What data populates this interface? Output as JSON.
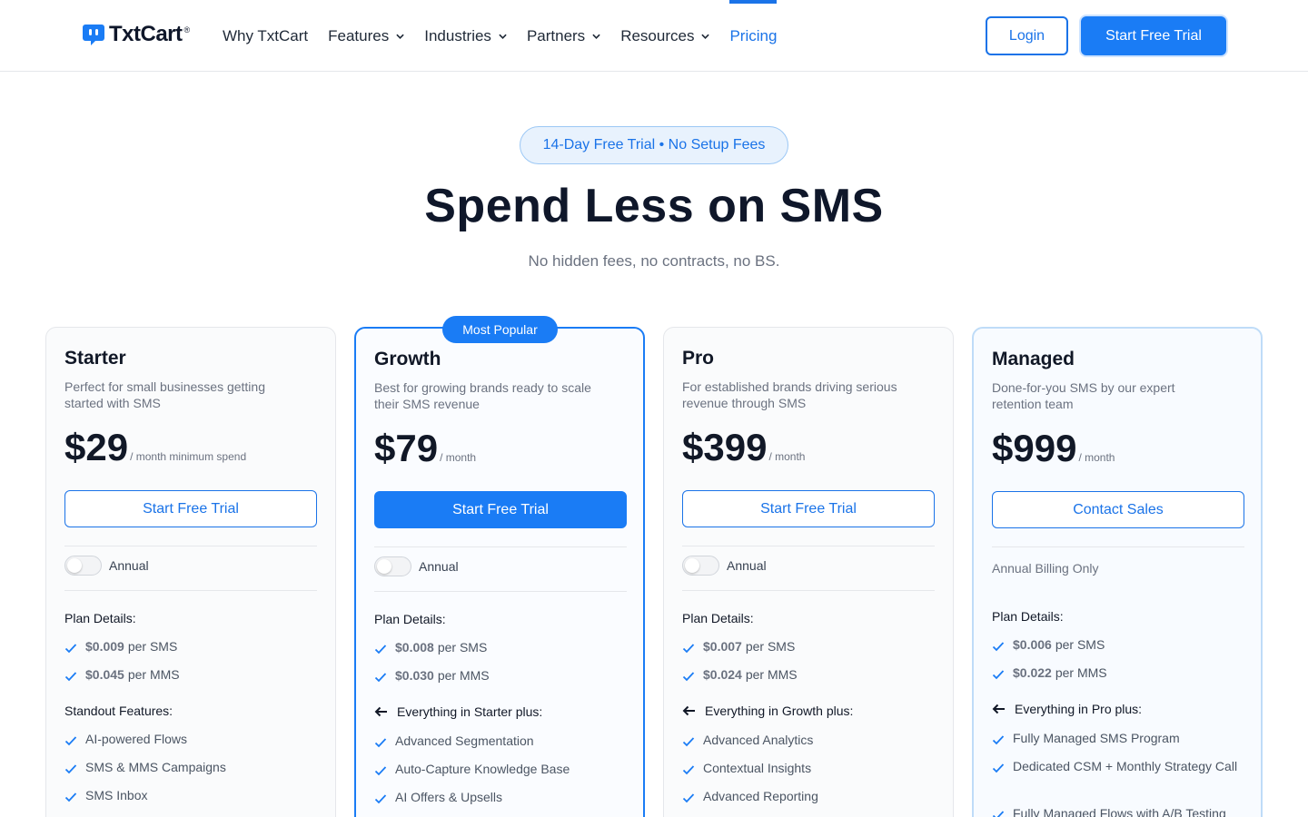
{
  "brand": {
    "name": "TxtCart",
    "reg": "®"
  },
  "nav": {
    "items": [
      {
        "label": "Why TxtCart",
        "dropdown": false
      },
      {
        "label": "Features",
        "dropdown": true
      },
      {
        "label": "Industries",
        "dropdown": true
      },
      {
        "label": "Partners",
        "dropdown": true
      },
      {
        "label": "Resources",
        "dropdown": true
      },
      {
        "label": "Pricing",
        "dropdown": false,
        "active": true
      }
    ],
    "login": "Login",
    "trial": "Start Free Trial"
  },
  "hero": {
    "badge": "14-Day Free Trial • No Setup Fees",
    "title": "Spend Less on SMS",
    "subtitle": "No hidden fees, no contracts, no BS."
  },
  "colors": {
    "accent": "#1a7cf5",
    "text": "#111827",
    "muted": "#6b7280"
  },
  "plans": [
    {
      "name": "Starter",
      "description": "Perfect for small businesses getting started with SMS",
      "price": "$29",
      "unit": "/ month minimum spend",
      "cta": "Start Free Trial",
      "toggle_label": "Annual",
      "details_label": "Plan Details:",
      "rates": [
        {
          "value": "$0.009",
          "label": "per SMS"
        },
        {
          "value": "$0.045",
          "label": "per MMS"
        }
      ],
      "features_label": "Standout Features:",
      "features": [
        "AI-powered Flows",
        "SMS & MMS Campaigns",
        "SMS Inbox"
      ]
    },
    {
      "name": "Growth",
      "tag": "Most Popular",
      "description": "Best for growing brands ready to scale their SMS revenue",
      "price": "$79",
      "unit": "/ month",
      "cta": "Start Free Trial",
      "toggle_label": "Annual",
      "details_label": "Plan Details:",
      "rates": [
        {
          "value": "$0.008",
          "label": "per SMS"
        },
        {
          "value": "$0.030",
          "label": "per MMS"
        }
      ],
      "features_label": "Everything in Starter plus:",
      "features": [
        "Advanced Segmentation",
        "Auto-Capture Knowledge Base",
        "AI Offers & Upsells"
      ]
    },
    {
      "name": "Pro",
      "description": "For established brands driving serious revenue through SMS",
      "price": "$399",
      "unit": "/ month",
      "cta": "Start Free Trial",
      "toggle_label": "Annual",
      "details_label": "Plan Details:",
      "rates": [
        {
          "value": "$0.007",
          "label": "per SMS"
        },
        {
          "value": "$0.024",
          "label": "per MMS"
        }
      ],
      "features_label": "Everything in Growth plus:",
      "features": [
        "Advanced Analytics",
        "Contextual Insights",
        "Advanced Reporting"
      ]
    },
    {
      "name": "Managed",
      "description": "Done-for-you SMS by our expert retention team",
      "price": "$999",
      "unit": "/ month",
      "cta": "Contact Sales",
      "billing_note": "Annual Billing Only",
      "details_label": "Plan Details:",
      "rates": [
        {
          "value": "$0.006",
          "label": "per SMS"
        },
        {
          "value": "$0.022",
          "label": "per MMS"
        }
      ],
      "features_label": "Everything in Pro plus:",
      "features": [
        "Fully Managed SMS Program",
        "Dedicated CSM + Monthly Strategy Call",
        "Fully Managed Flows with A/B Testing"
      ]
    }
  ]
}
